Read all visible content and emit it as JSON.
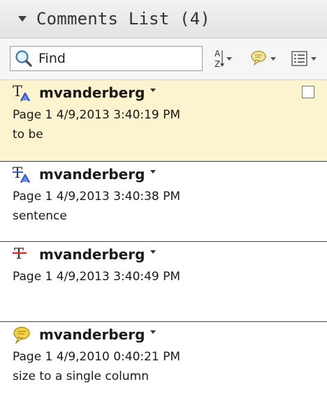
{
  "panel": {
    "title": "Comments List (4)"
  },
  "toolbar": {
    "find_placeholder": "Find",
    "sort_icon": "sort-az-icon",
    "filter_icon": "comment-filter-icon",
    "options_icon": "list-options-icon"
  },
  "comments": [
    {
      "icon": "text-insert-icon",
      "author": "mvanderberg",
      "meta": "Page 1  4/9,2013 3:40:19 PM",
      "text": "to be",
      "selected": true
    },
    {
      "icon": "text-replace-icon",
      "author": "mvanderberg",
      "meta": "Page 1  4/9,2013 3:40:38 PM",
      "text": "sentence",
      "selected": false
    },
    {
      "icon": "strikethrough-icon",
      "author": "mvanderberg",
      "meta": "Page 1  4/9,2013 3:40:49 PM",
      "text": "",
      "selected": false
    },
    {
      "icon": "sticky-note-icon",
      "author": "mvanderberg",
      "meta": "Page 1  4/9,2010 0:40:21 PM",
      "text": "size to a single column",
      "selected": false
    }
  ],
  "colors": {
    "selected_bg": "#fcf3cf",
    "insert_blue": "#3a5fcd",
    "strike_red": "#d03030",
    "note_yellow": "#f3d24a"
  }
}
